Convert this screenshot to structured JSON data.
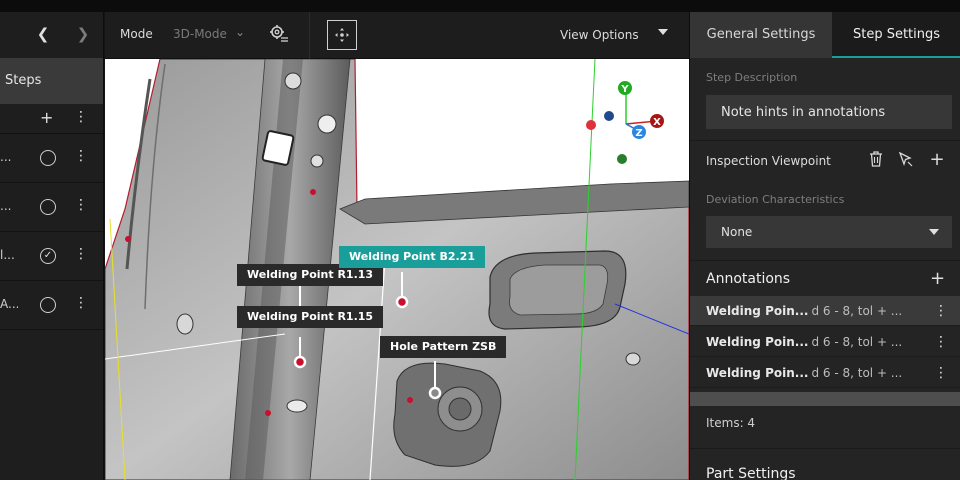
{
  "left_panel": {
    "steps_title": "Steps",
    "steps": [
      {
        "label": "...",
        "status": "pending"
      },
      {
        "label": "...",
        "status": "pending"
      },
      {
        "label": "l...",
        "status": "done"
      },
      {
        "label": "A...",
        "status": "pending"
      }
    ],
    "done_glyph": "✓"
  },
  "toolbar": {
    "mode_label": "Mode",
    "mode_value": "3D-Mode",
    "view_options_label": "View Options"
  },
  "viewport": {
    "callouts": [
      {
        "label": "Welding Point R1.13",
        "style": "dark"
      },
      {
        "label": "Welding Point R1.15",
        "style": "dark"
      },
      {
        "label": "Welding Point B2.21",
        "style": "teal"
      },
      {
        "label": "Hole Pattern ZSB",
        "style": "dark"
      }
    ],
    "axis_labels": {
      "y": "Y",
      "z": "Z",
      "x": "X"
    }
  },
  "right_panel": {
    "tabs": [
      "General Settings",
      "Step Settings"
    ],
    "active_tab": "Step Settings",
    "step_description_label": "Step Description",
    "step_description_value": "Note hints in annotations",
    "inspection_viewpoint_label": "Inspection Viewpoint",
    "deviation_label": "Deviation Characteristics",
    "deviation_value": "None",
    "annotations_label": "Annotations",
    "annotations": [
      {
        "name": "Welding Poin...",
        "detail": "d 6 - 8, tol + ..."
      },
      {
        "name": "Welding Poin...",
        "detail": "d 6 - 8, tol + ..."
      },
      {
        "name": "Welding Poin...",
        "detail": "d 6 - 8, tol + ..."
      }
    ],
    "items_count": "Items: 4",
    "part_settings_label": "Part Settings"
  },
  "colors": {
    "accent_teal": "#1a9e9a",
    "panel_bg": "#242424",
    "marker_red": "#c8102e"
  }
}
